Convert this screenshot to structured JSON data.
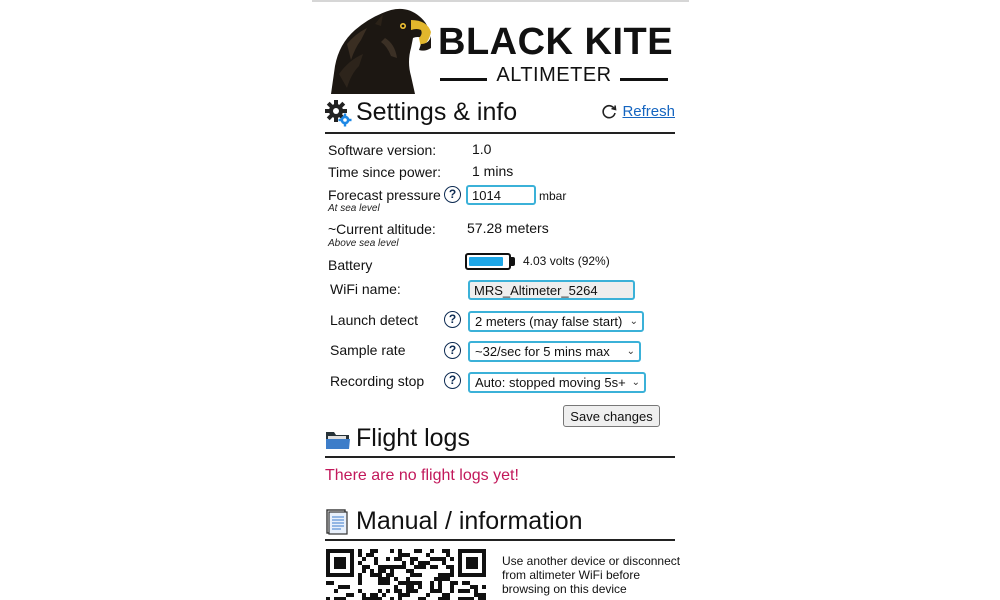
{
  "brand": {
    "title": "BLACK KITE",
    "subtitle": "ALTIMETER",
    "logo_icon": "eagle-head-icon"
  },
  "settings": {
    "title": "Settings & info",
    "icon": "gear-icon",
    "refresh_icon": "refresh-icon",
    "refresh_label": "Refresh",
    "software_version_label": "Software version:",
    "software_version_value": "1.0",
    "time_since_power_label": "Time since power:",
    "time_since_power_value": "1 mins",
    "forecast_pressure_label": "Forecast pressure",
    "forecast_pressure_sub": "At sea level",
    "forecast_pressure_value": "1014",
    "forecast_pressure_unit": "mbar",
    "current_altitude_label": "~Current altitude:",
    "current_altitude_sub": "Above sea level",
    "current_altitude_value": "57.28 meters",
    "battery_label": "Battery",
    "battery_value": "4.03 volts (92%)",
    "battery_level": 0.92,
    "battery_color": "#1ea7e8",
    "wifi_label": "WiFi name:",
    "wifi_value": "MRS_Altimeter_5264",
    "launch_detect_label": "Launch detect",
    "launch_detect_value": "2 meters (may false start)",
    "sample_rate_label": "Sample rate",
    "sample_rate_value": "~32/sec for 5 mins max",
    "recording_stop_label": "Recording stop",
    "recording_stop_value": "Auto: stopped moving 5s+",
    "help_glyph": "?",
    "save_label": "Save changes",
    "accent_color": "#3bb1d8"
  },
  "flight_logs": {
    "title": "Flight logs",
    "icon": "folder-icon",
    "empty_message": "There are no flight logs yet!",
    "empty_color": "#c2185b"
  },
  "manual": {
    "title": "Manual / information",
    "icon": "document-icon",
    "qr_icon": "qr-code-icon",
    "note": "Use another device or disconnect from altimeter WiFi before browsing on this device"
  }
}
